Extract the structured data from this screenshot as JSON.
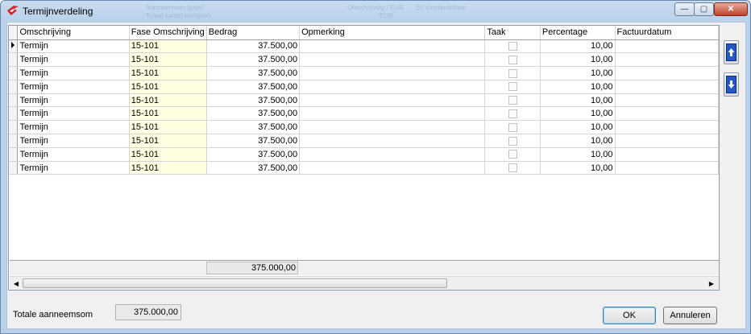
{
  "window": {
    "title": "Termijnverdeling",
    "ghost_texts": [
      "Aanneemsom [prijs]",
      "Totaal aantal termijnen",
      "Omschrijving / EUR",
      "EUR",
      "10 Voorbeeldfase"
    ],
    "buttons": {
      "minimize": "—",
      "maximize": "▢",
      "close": "✕"
    }
  },
  "grid": {
    "columns": [
      "Omschrijving",
      "Fase Omschrijving",
      "Bedrag",
      "Opmerking",
      "Taak",
      "Percentage",
      "Factuurdatum"
    ],
    "rows": [
      {
        "omschrijving": "Termijn",
        "fase": "15-101",
        "bedrag": "37.500,00",
        "opmerking": "",
        "taak": false,
        "percentage": "10,00",
        "factuurdatum": ""
      },
      {
        "omschrijving": "Termijn",
        "fase": "15-101",
        "bedrag": "37.500,00",
        "opmerking": "",
        "taak": false,
        "percentage": "10,00",
        "factuurdatum": ""
      },
      {
        "omschrijving": "Termijn",
        "fase": "15-101",
        "bedrag": "37.500,00",
        "opmerking": "",
        "taak": false,
        "percentage": "10,00",
        "factuurdatum": ""
      },
      {
        "omschrijving": "Termijn",
        "fase": "15-101",
        "bedrag": "37.500,00",
        "opmerking": "",
        "taak": false,
        "percentage": "10,00",
        "factuurdatum": ""
      },
      {
        "omschrijving": "Termijn",
        "fase": "15-101",
        "bedrag": "37.500,00",
        "opmerking": "",
        "taak": false,
        "percentage": "10,00",
        "factuurdatum": ""
      },
      {
        "omschrijving": "Termijn",
        "fase": "15-101",
        "bedrag": "37.500,00",
        "opmerking": "",
        "taak": false,
        "percentage": "10,00",
        "factuurdatum": ""
      },
      {
        "omschrijving": "Termijn",
        "fase": "15-101",
        "bedrag": "37.500,00",
        "opmerking": "",
        "taak": false,
        "percentage": "10,00",
        "factuurdatum": ""
      },
      {
        "omschrijving": "Termijn",
        "fase": "15-101",
        "bedrag": "37.500,00",
        "opmerking": "",
        "taak": false,
        "percentage": "10,00",
        "factuurdatum": ""
      },
      {
        "omschrijving": "Termijn",
        "fase": "15-101",
        "bedrag": "37.500,00",
        "opmerking": "",
        "taak": false,
        "percentage": "10,00",
        "factuurdatum": ""
      },
      {
        "omschrijving": "Termijn",
        "fase": "15-101",
        "bedrag": "37.500,00",
        "opmerking": "",
        "taak": false,
        "percentage": "10,00",
        "factuurdatum": ""
      }
    ],
    "total_bedrag": "375.000,00",
    "selected_row": 0
  },
  "side_buttons": {
    "move_up_icon": "arrow-up-icon",
    "move_down_icon": "arrow-down-icon"
  },
  "footer": {
    "total_label": "Totale aanneemsom",
    "total_value": "375.000,00",
    "ok_label": "OK",
    "cancel_label": "Annuleren"
  },
  "colors": {
    "fase_cell_bg": "#ffffe1",
    "side_icon": "#2458c6",
    "close_button": "#c0412a"
  }
}
